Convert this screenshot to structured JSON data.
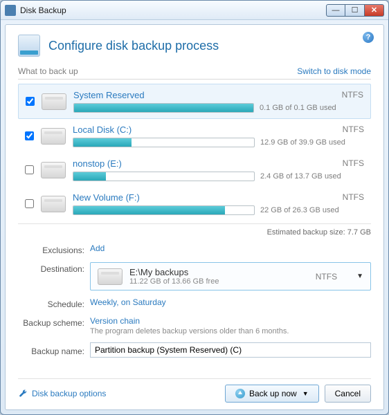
{
  "window": {
    "title": "Disk Backup"
  },
  "page": {
    "title": "Configure disk backup process",
    "section_label": "What to back up",
    "switch_link": "Switch to disk mode"
  },
  "volumes": [
    {
      "name": "System Reserved",
      "fs": "NTFS",
      "usage": "0.1 GB of 0.1 GB used",
      "pct": 100,
      "checked": true,
      "selected": true
    },
    {
      "name": "Local Disk (C:)",
      "fs": "NTFS",
      "usage": "12.9 GB of 39.9 GB used",
      "pct": 32,
      "checked": true,
      "selected": false
    },
    {
      "name": "nonstop (E:)",
      "fs": "NTFS",
      "usage": "2.4 GB of 13.7 GB used",
      "pct": 18,
      "checked": false,
      "selected": false
    },
    {
      "name": "New Volume (F:)",
      "fs": "NTFS",
      "usage": "22 GB of 26.3 GB used",
      "pct": 84,
      "checked": false,
      "selected": false
    }
  ],
  "estimated": "Estimated backup size:  7.7 GB",
  "form": {
    "exclusions_label": "Exclusions:",
    "exclusions_add": "Add",
    "destination_label": "Destination:",
    "destination": {
      "path": "E:\\My backups",
      "free": "11.22 GB of 13.66 GB free",
      "fs": "NTFS"
    },
    "schedule_label": "Schedule:",
    "schedule_value": "Weekly, on Saturday",
    "scheme_label": "Backup scheme:",
    "scheme_value": "Version chain",
    "scheme_desc": "The program deletes backup versions older than 6 months.",
    "name_label": "Backup name:",
    "name_value": "Partition backup (System Reserved) (C)"
  },
  "footer": {
    "options": "Disk backup options",
    "backup_now": "Back up now",
    "cancel": "Cancel"
  },
  "chart_data": {
    "type": "bar",
    "title": "Disk usage",
    "series": [
      {
        "name": "System Reserved",
        "used_gb": 0.1,
        "total_gb": 0.1
      },
      {
        "name": "Local Disk (C:)",
        "used_gb": 12.9,
        "total_gb": 39.9
      },
      {
        "name": "nonstop (E:)",
        "used_gb": 2.4,
        "total_gb": 13.7
      },
      {
        "name": "New Volume (F:)",
        "used_gb": 22,
        "total_gb": 26.3
      }
    ]
  }
}
